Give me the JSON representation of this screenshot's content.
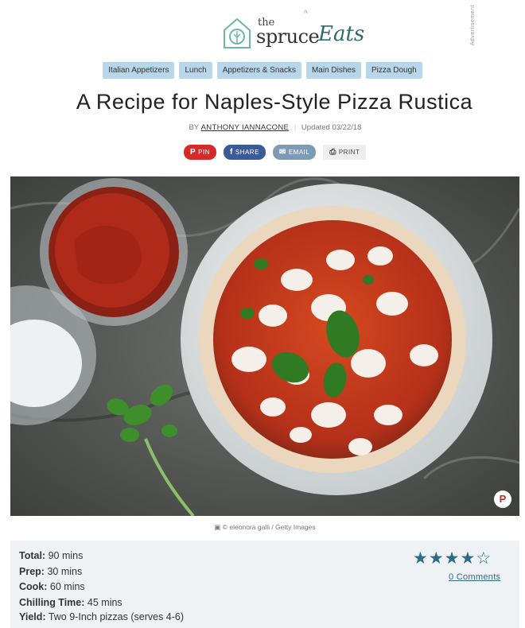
{
  "header": {
    "logo_the": "the",
    "logo_spruce": "spruce",
    "logo_eats": "Eats",
    "ad_label": "Advertisement"
  },
  "tags": [
    "Italian Appetizers",
    "Lunch",
    "Appetizers & Snacks",
    "Main Dishes",
    "Pizza Dough"
  ],
  "article": {
    "title": "A Recipe for Naples-Style Pizza Rustica",
    "by": "BY",
    "author": "ANTHONY IANNACONE",
    "updated": "Updated 03/22/18"
  },
  "share": {
    "pin": "PIN",
    "share": "SHARE",
    "email": "EMAIL",
    "print": "PRINT"
  },
  "image": {
    "credit": "© eleonora galli / Getty Images"
  },
  "recipe": {
    "total_label": "Total:",
    "total_value": "90 mins",
    "prep_label": "Prep:",
    "prep_value": "30 mins",
    "cook_label": "Cook:",
    "cook_value": "60 mins",
    "chill_label": "Chilling Time:",
    "chill_value": "45 mins",
    "yield_label": "Yield:",
    "yield_value": "Two 9-Inch pizzas (serves 4-6)",
    "rating": 4,
    "rating_max": 5,
    "comments": "0 Comments"
  },
  "colors": {
    "tag_bg": "#b7d6ea",
    "pin": "#d62b2b",
    "facebook": "#3b5a98",
    "email": "#7f9bb4",
    "accent": "#2f6a86"
  }
}
